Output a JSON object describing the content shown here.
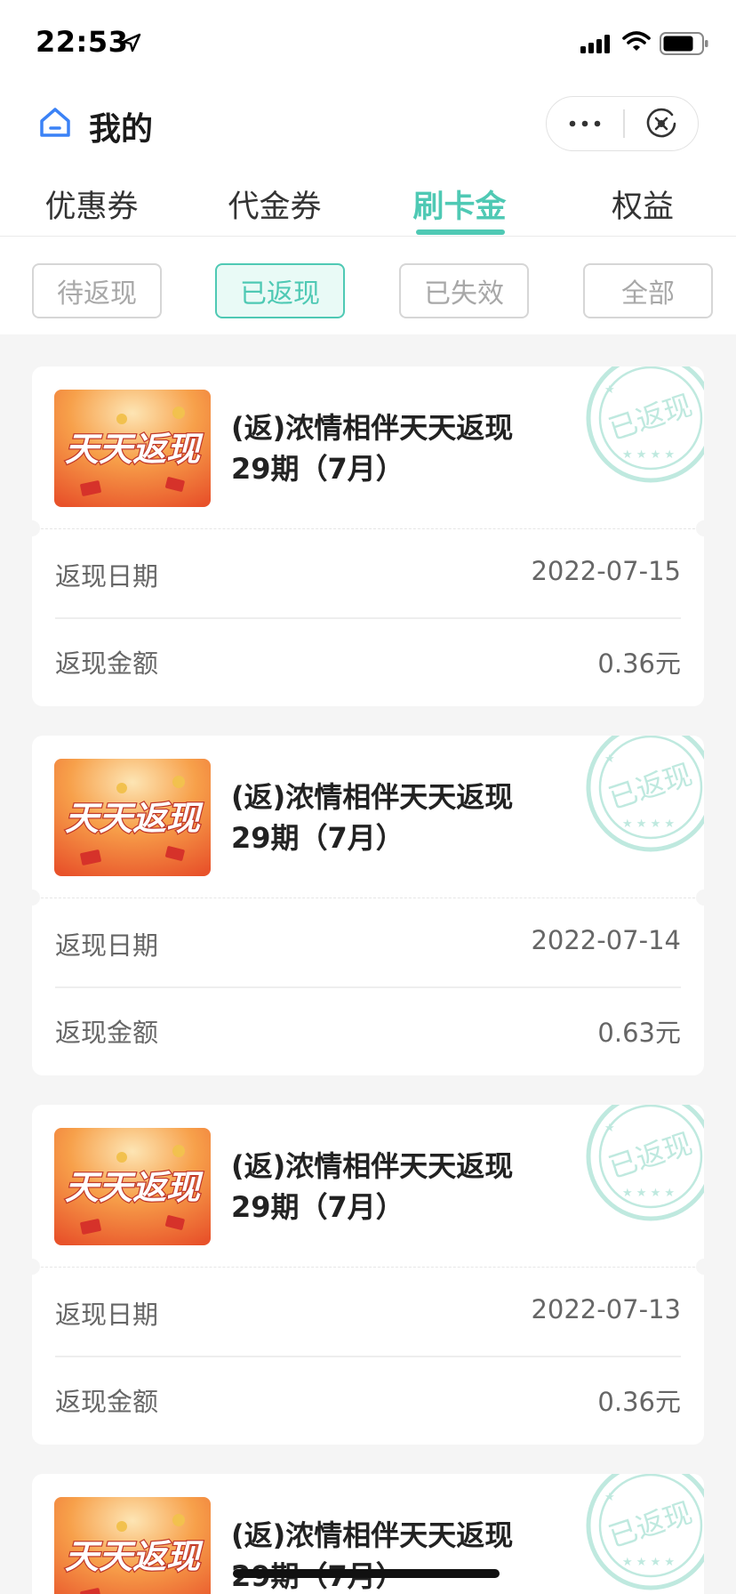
{
  "status_bar": {
    "time": "22:53"
  },
  "header": {
    "title": "我的"
  },
  "tabs": [
    {
      "label": "优惠券",
      "active": false
    },
    {
      "label": "代金券",
      "active": false
    },
    {
      "label": "刷卡金",
      "active": true
    },
    {
      "label": "权益",
      "active": false
    }
  ],
  "filters": [
    {
      "label": "待返现",
      "active": false
    },
    {
      "label": "已返现",
      "active": true
    },
    {
      "label": "已失效",
      "active": false
    },
    {
      "label": "全部",
      "active": false
    }
  ],
  "cards": [
    {
      "title": "(返)浓情相伴天天返现29期（7月）",
      "thumb_text": "天天返现",
      "stamp_text": "已返现",
      "date_label": "返现日期",
      "date_value": "2022-07-15",
      "amount_label": "返现金额",
      "amount_value": "0.36元"
    },
    {
      "title": "(返)浓情相伴天天返现29期（7月）",
      "thumb_text": "天天返现",
      "stamp_text": "已返现",
      "date_label": "返现日期",
      "date_value": "2022-07-14",
      "amount_label": "返现金额",
      "amount_value": "0.63元"
    },
    {
      "title": "(返)浓情相伴天天返现29期（7月）",
      "thumb_text": "天天返现",
      "stamp_text": "已返现",
      "date_label": "返现日期",
      "date_value": "2022-07-13",
      "amount_label": "返现金额",
      "amount_value": "0.36元"
    },
    {
      "title": "(返)浓情相伴天天返现29期（7月）",
      "thumb_text": "天天返现",
      "stamp_text": "已返现",
      "date_label": "",
      "date_value": "",
      "amount_label": "",
      "amount_value": ""
    }
  ],
  "colors": {
    "accent": "#4fc9b4",
    "background": "#f5f5f5",
    "card": "#ffffff",
    "thumb_orange": "#f26a2e"
  },
  "icons": [
    "location-arrow-icon",
    "signal-icon",
    "wifi-icon",
    "battery-icon",
    "home-icon",
    "more-icon",
    "close-icon",
    "stamp-icon"
  ]
}
